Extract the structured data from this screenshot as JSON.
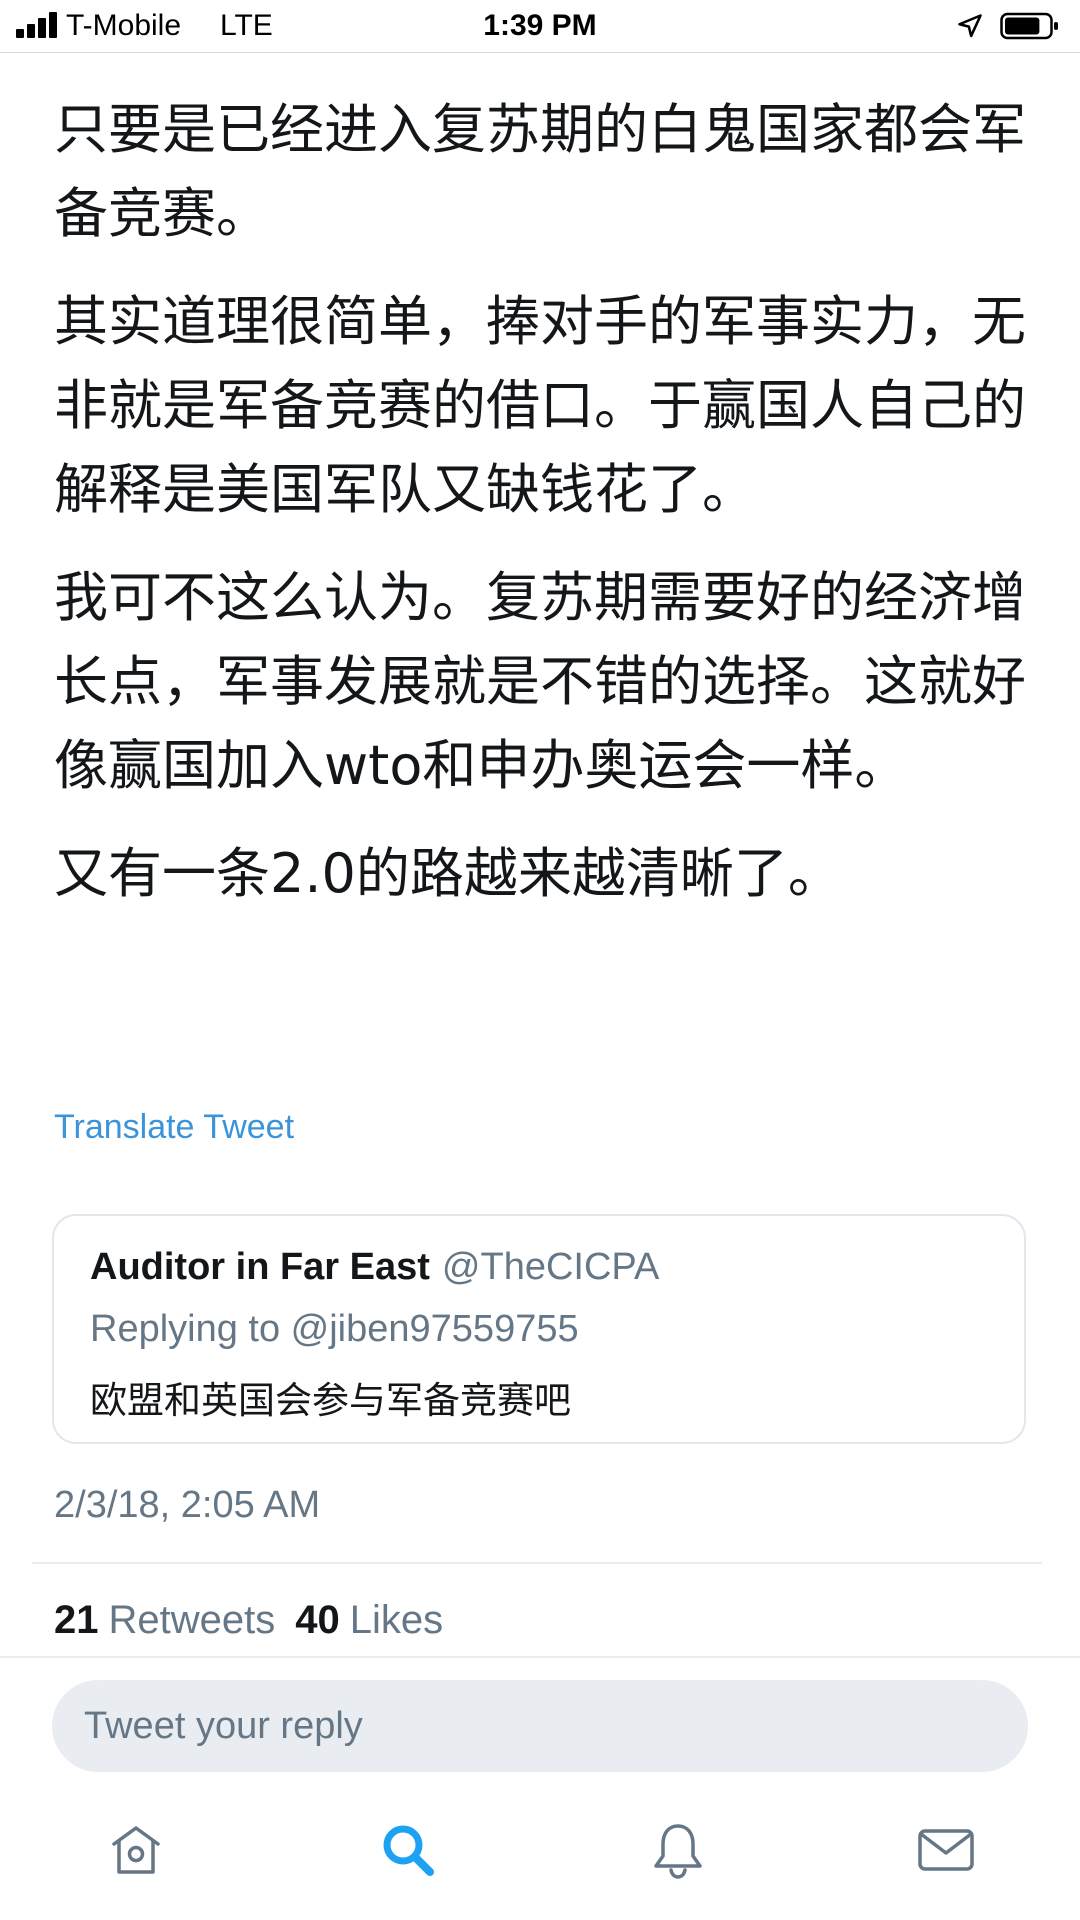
{
  "status_bar": {
    "carrier": "T-Mobile",
    "network": "LTE",
    "time": "1:39 PM",
    "signal_bars": 4,
    "battery_level": 0.8,
    "icons": [
      "signal-icon",
      "location-icon",
      "battery-icon"
    ]
  },
  "tweet": {
    "paragraphs": [
      "只要是已经进入复苏期的白鬼国家都会军备竞赛。",
      "其实道理很简单，捧对手的军事实力，无非就是军备竞赛的借口。于赢国人自己的解释是美国军队又缺钱花了。",
      "我可不这么认为。复苏期需要好的经济增长点，军事发展就是不错的选择。这就好像赢国加入wto和申办奥运会一样。",
      "又有一条2.0的路越来越清晰了。"
    ],
    "translate_label": "Translate Tweet",
    "timestamp": "2/3/18, 2:05 AM"
  },
  "quoted_tweet": {
    "name": "Auditor in Far East",
    "handle": "@TheCICPA",
    "replying_to": "Replying to @jiben97559755",
    "text": "欧盟和英国会参与军备竞赛吧"
  },
  "stats": {
    "retweets_count": "21",
    "retweets_label": "Retweets",
    "likes_count": "40",
    "likes_label": "Likes"
  },
  "reply": {
    "placeholder": "Tweet your reply"
  },
  "tab_bar": {
    "tabs": [
      {
        "id": "home",
        "icon": "home-icon",
        "active": false
      },
      {
        "id": "search",
        "icon": "search-icon",
        "active": true
      },
      {
        "id": "notifications",
        "icon": "bell-icon",
        "active": false
      },
      {
        "id": "messages",
        "icon": "mail-icon",
        "active": false
      }
    ]
  },
  "colors": {
    "link": "#3b94d9",
    "active_tab": "#1da1f2",
    "inactive_tab": "#657786",
    "secondary_text": "#657786",
    "primary_text": "#14171a"
  }
}
